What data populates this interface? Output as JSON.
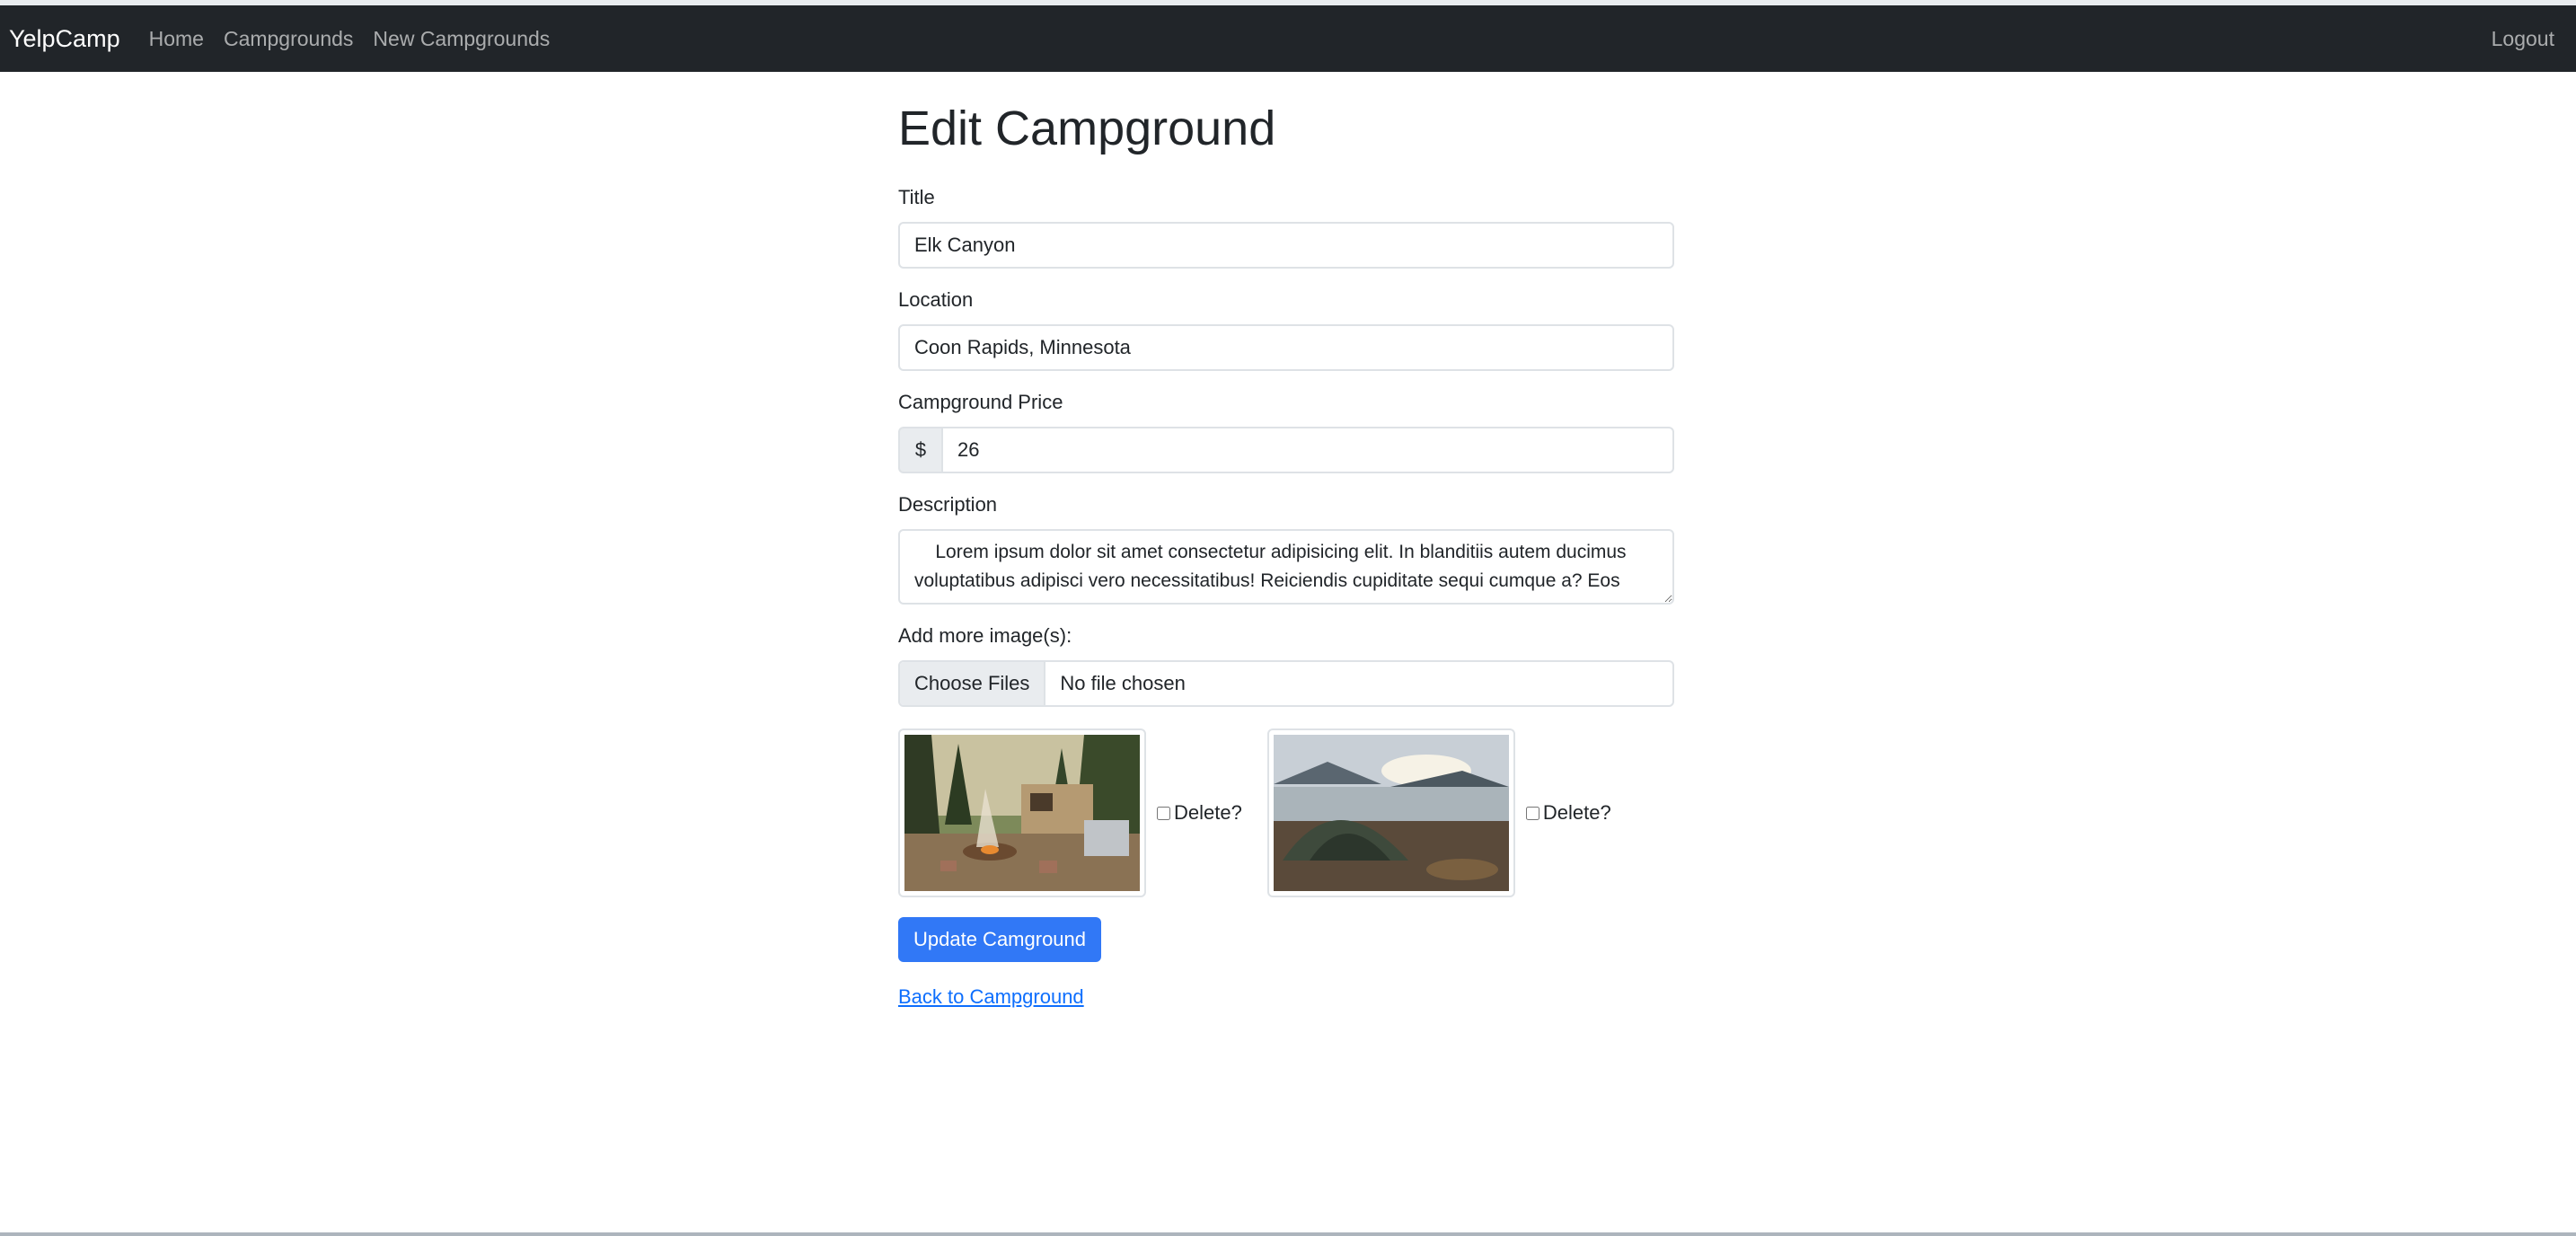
{
  "navbar": {
    "brand": "YelpCamp",
    "links": [
      "Home",
      "Campgrounds",
      "New Campgrounds"
    ],
    "logout": "Logout"
  },
  "form": {
    "heading": "Edit Campground",
    "title_label": "Title",
    "title_value": "Elk Canyon",
    "location_label": "Location",
    "location_value": "Coon Rapids, Minnesota",
    "price_label": "Campground Price",
    "price_prefix": "$",
    "price_value": "26",
    "description_label": "Description",
    "description_value": "    Lorem ipsum dolor sit amet consectetur adipisicing elit. In blanditiis autem ducimus voluptatibus adipisci vero necessitatibus! Reiciendis cupiditate sequi cumque a? Eos",
    "images_label": "Add more image(s):",
    "file_button": "Choose Files",
    "file_status": "No file chosen",
    "images": [
      {
        "alt": "campfire-camper-image",
        "delete_label": "Delete?",
        "checked": false
      },
      {
        "alt": "tent-lake-image",
        "delete_label": "Delete?",
        "checked": false
      }
    ],
    "submit": "Update Camground",
    "back_link": "Back to Campground"
  }
}
